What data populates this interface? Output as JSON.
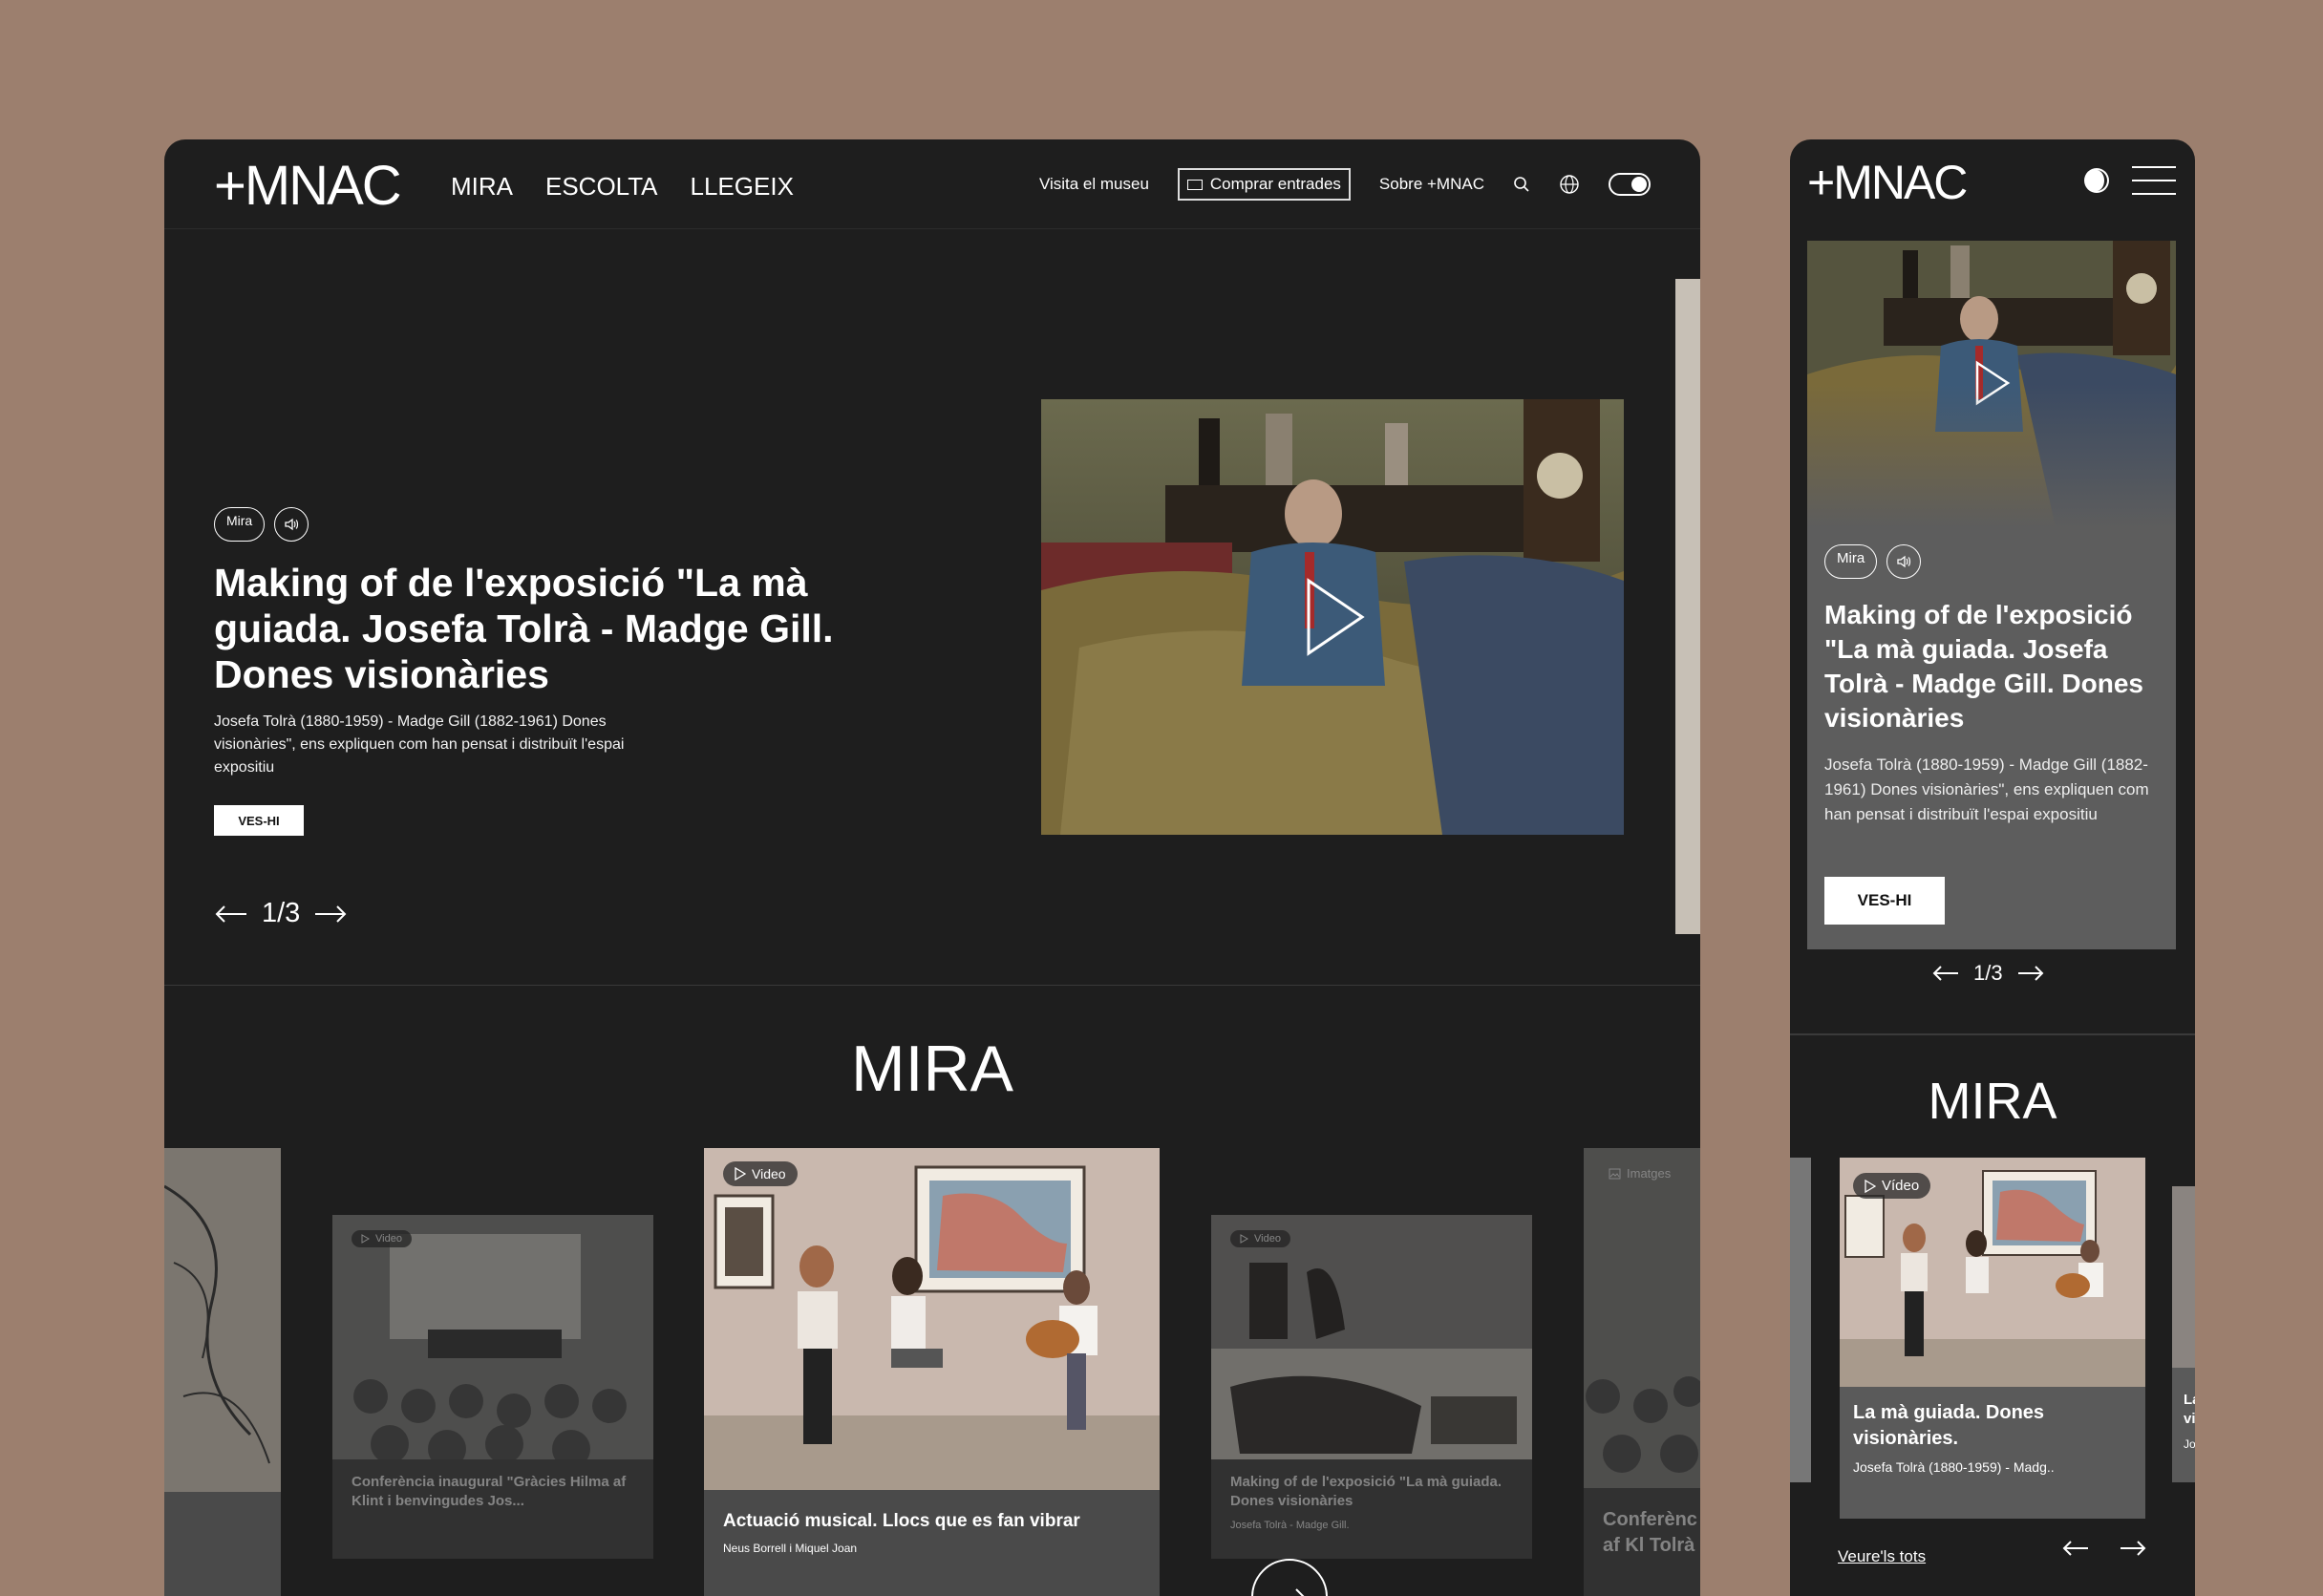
{
  "desktop": {
    "header": {
      "logo": "+MNAC",
      "nav": [
        "MIRA",
        "ESCOLTA",
        "LLEGEIX"
      ],
      "visit": "Visita el museu",
      "buy": "Comprar entrades",
      "about": "Sobre +MNAC"
    },
    "hero": {
      "tag": "Mira",
      "title": "Making of de l'exposició \"La mà guiada. Josefa Tolrà - Madge Gill. Dones visionàries",
      "description": "Josefa Tolrà (1880-1959) - Madge Gill (1882-1961) Dones visionàries\", ens expliquen com han pensat i distribuït l'espai expositiu",
      "button": "VES-HI",
      "pager": "1/3"
    },
    "section_title": "MIRA",
    "cards": [
      {
        "badge": "Video",
        "title": "Conferència inaugural \"Gràcies Hilma af Klint i benvingudes Jos...",
        "subtitle": ""
      },
      {
        "badge": "Video",
        "title": "Actuació musical. Llocs que es fan vibrar",
        "subtitle": "Neus Borrell i Miquel Joan"
      },
      {
        "badge": "Video",
        "title": "Making of de l'exposició \"La mà guiada. Dones visionàries",
        "subtitle": "Josefa Tolrà - Madge Gill."
      },
      {
        "badge": "Imatges",
        "title": "Conferènc Hilma af Kl Tolrà i Mad",
        "subtitle": ""
      }
    ]
  },
  "mobile": {
    "logo": "+MNAC",
    "hero": {
      "tag": "Mira",
      "title": "Making of de l'exposició \"La mà guiada. Josefa Tolrà - Madge Gill. Dones visionàries",
      "description": "Josefa Tolrà (1880-1959) - Madge Gill (1882-1961) Dones visionàries\", ens expliquen com han pensat i distribuït l'espai expositiu",
      "button": "VES-HI",
      "pager": "1/3"
    },
    "section_title": "MIRA",
    "card": {
      "badge": "Vídeo",
      "title": "La mà guiada. Dones visionàries.",
      "subtitle": "Josefa Tolrà (1880-1959) - Madg.."
    },
    "peek_card": {
      "title": "La vi",
      "subtitle": "Jo"
    },
    "see_all": "Veure'ls tots"
  }
}
